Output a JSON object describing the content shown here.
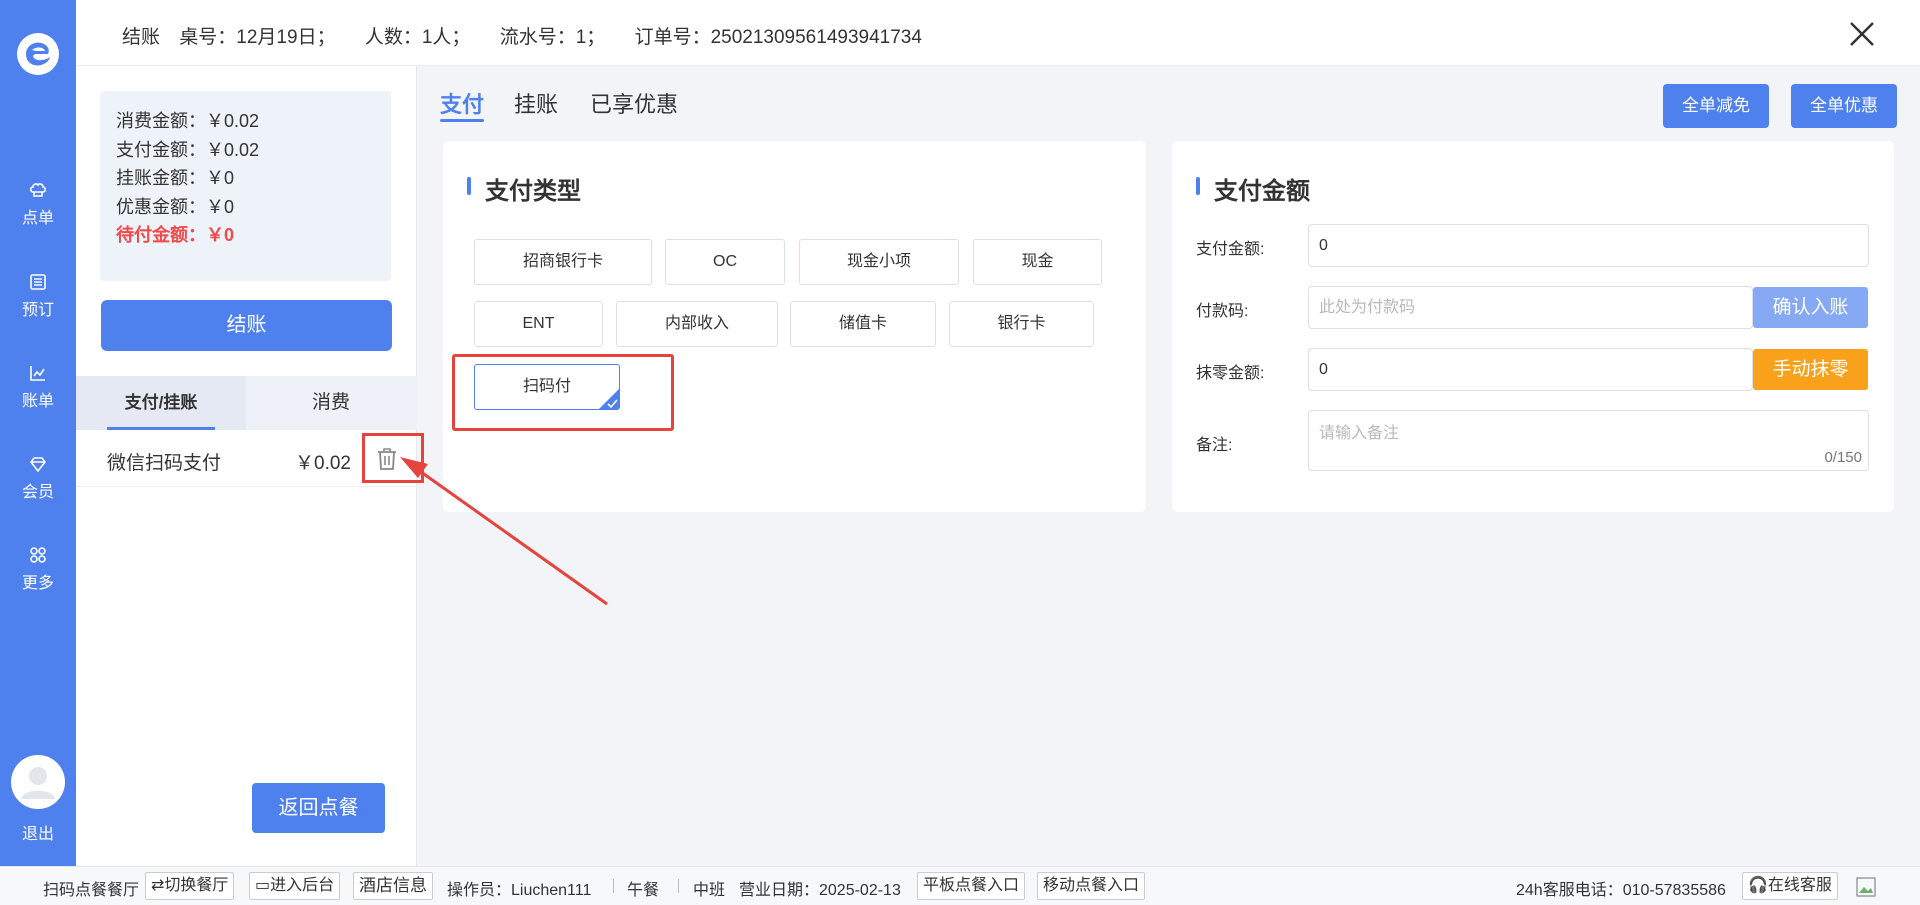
{
  "nav": {
    "items": [
      {
        "label": "点单",
        "icon": "chef-hat-icon"
      },
      {
        "label": "预订",
        "icon": "book-icon"
      },
      {
        "label": "账单",
        "icon": "chart-icon"
      },
      {
        "label": "会员",
        "icon": "diamond-icon"
      },
      {
        "label": "更多",
        "icon": "grid-icon"
      }
    ],
    "exit": "退出"
  },
  "header": {
    "title": "结账",
    "table": "桌号：12月19日；",
    "people": "人数：1人；",
    "serial": "流水号：1；",
    "order": "订单号：25021309561493941734"
  },
  "summary": {
    "consume": "消费金额：￥0.02",
    "paid": "支付金额：￥0.02",
    "credit": "挂账金额：￥0",
    "discount": "优惠金额：￥0",
    "due": "待付金额：￥0"
  },
  "left": {
    "settle": "结账",
    "tabs": [
      "支付/挂账",
      "消费"
    ],
    "payment_row": {
      "name": "微信扫码支付",
      "amount": "￥0.02"
    },
    "back": "返回点餐"
  },
  "main": {
    "tabs": [
      "支付",
      "挂账",
      "已享优惠"
    ],
    "btn_full_reduce": "全单减免",
    "btn_full_discount": "全单优惠",
    "pay_type_title": "支付类型",
    "pay_types": [
      "招商银行卡",
      "OC",
      "现金小项",
      "现金",
      "ENT",
      "内部收入",
      "储值卡",
      "银行卡",
      "扫码付"
    ],
    "selected_pay_type": "扫码付",
    "amount_title": "支付金额",
    "fields": {
      "amount_label": "支付金额:",
      "amount_value": "0",
      "code_label": "付款码:",
      "code_placeholder": "此处为付款码",
      "confirm_btn": "确认入账",
      "round_label": "抹零金额:",
      "round_value": "0",
      "round_btn": "手动抹零",
      "note_label": "备注:",
      "note_placeholder": "请输入备注",
      "note_counter": "0/150"
    }
  },
  "colors": {
    "primary": "#4e80ee",
    "warning": "#f9a11b",
    "danger": "#f04a4a",
    "annotation": "#e5443d"
  },
  "footer": {
    "restaurant": "扫码点餐餐厅",
    "switch": "切换餐厅",
    "backend": "进入后台",
    "hotel_info": "酒店信息",
    "operator": "操作员：Liuchen111",
    "meal": "午餐",
    "shift": "中班",
    "business_date": "营业日期：2025-02-13",
    "tablet_entry": "平板点餐入口",
    "mobile_entry": "移动点餐入口",
    "hotline": "24h客服电话：010-57835586",
    "online_service": "在线客服"
  }
}
